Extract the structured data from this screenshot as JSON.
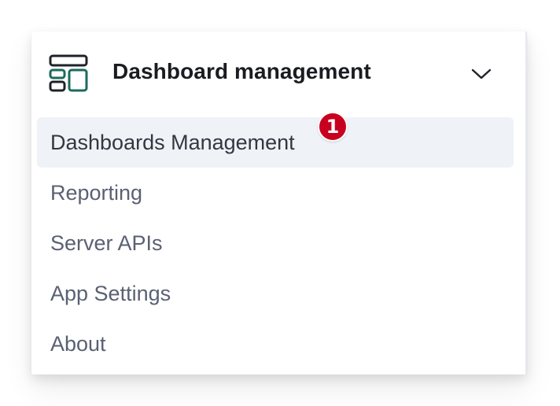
{
  "panel": {
    "title": "Dashboard management",
    "title_icon": "dashboard-layout-icon",
    "toggle_icon": "chevron-down-icon",
    "expanded": true
  },
  "nav": {
    "items": [
      {
        "label": "Dashboards Management",
        "active": true
      },
      {
        "label": "Reporting",
        "active": false
      },
      {
        "label": "Server APIs",
        "active": false
      },
      {
        "label": "App Settings",
        "active": false
      },
      {
        "label": "About",
        "active": false
      }
    ]
  },
  "annotation": {
    "step_number": "1"
  },
  "colors": {
    "title_text": "#1a1c21",
    "item_text": "#5a6172",
    "active_item_text": "#343741",
    "active_item_bg": "#eff2f6",
    "icon_accent": "#1a6b5e",
    "badge_bg": "#c8001f"
  }
}
